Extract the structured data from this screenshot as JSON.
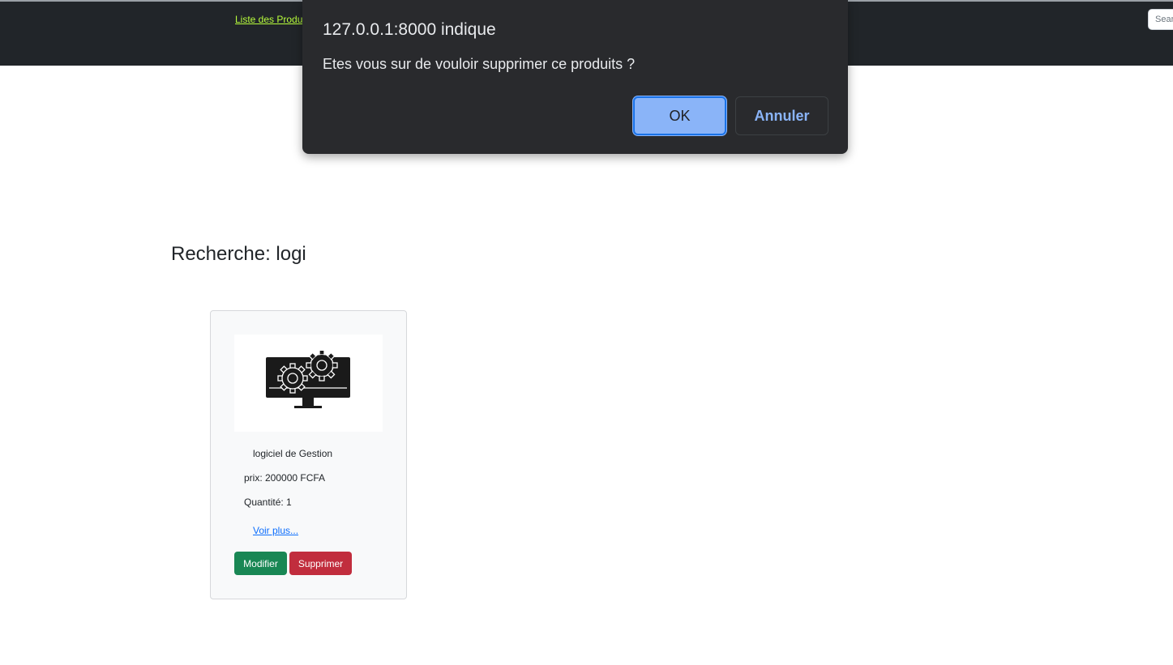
{
  "navbar": {
    "link_label": "Liste des Produits",
    "search_placeholder": "Search"
  },
  "main": {
    "heading": "Recherche: logi",
    "product": {
      "image_icon": "computer-gears-icon",
      "title": "logiciel de Gestion",
      "price": "prix: 200000 FCFA",
      "quantity": "Quantité: 1",
      "more_link": "Voir plus...",
      "edit_label": "Modifier",
      "delete_label": "Supprimer"
    }
  },
  "dialog": {
    "origin": "127.0.0.1:8000 indique",
    "message": "Etes vous sur de vouloir supprimer ce produits ?",
    "ok_label": "OK",
    "cancel_label": "Annuler"
  },
  "colors": {
    "navbar_bg": "#212529",
    "nav_link": "#b9ff3c",
    "edit_button": "#198754",
    "delete_button": "#c12d3d",
    "dialog_bg": "#292a2d",
    "dialog_accent": "#8ab4f8"
  }
}
